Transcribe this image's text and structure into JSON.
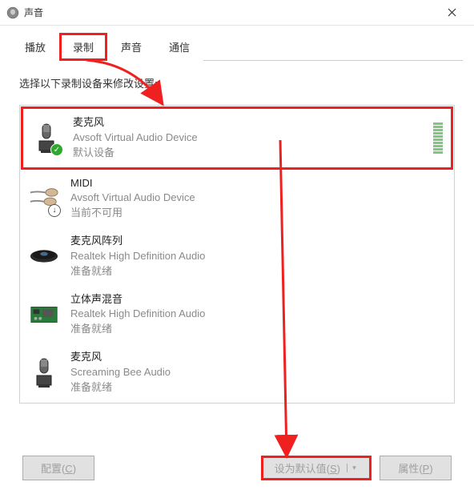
{
  "window": {
    "title": "声音"
  },
  "tabs": {
    "items": [
      {
        "label": "播放"
      },
      {
        "label": "录制"
      },
      {
        "label": "声音"
      },
      {
        "label": "通信"
      }
    ],
    "active": 1
  },
  "panel": {
    "instruction": "选择以下录制设备来修改设置:"
  },
  "devices": [
    {
      "name": "麦克风",
      "desc": "Avsoft Virtual Audio Device",
      "status": "默认设备",
      "icon": "mic-icon",
      "badge": "check",
      "show_meter": true
    },
    {
      "name": "MIDI",
      "desc": "Avsoft Virtual Audio Device",
      "status": "当前不可用",
      "icon": "cable-icon",
      "badge": "down",
      "show_meter": false
    },
    {
      "name": "麦克风阵列",
      "desc": "Realtek High Definition Audio",
      "status": "准备就绪",
      "icon": "array-mic-icon",
      "badge": null,
      "show_meter": false
    },
    {
      "name": "立体声混音",
      "desc": "Realtek High Definition Audio",
      "status": "准备就绪",
      "icon": "board-icon",
      "badge": null,
      "show_meter": false
    },
    {
      "name": "麦克风",
      "desc": "Screaming Bee Audio",
      "status": "准备就绪",
      "icon": "mic-icon",
      "badge": null,
      "show_meter": false
    }
  ],
  "buttons": {
    "configure": "配置(C)",
    "set_default": "设为默认值(S)",
    "properties": "属性(P)"
  }
}
